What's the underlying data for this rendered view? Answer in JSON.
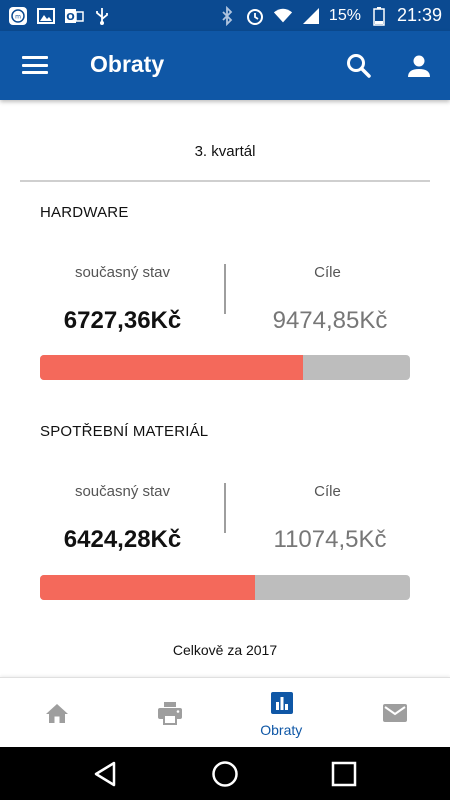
{
  "status_bar": {
    "battery": "15%",
    "time": "21:39",
    "icons": [
      "app-notification-icon",
      "gallery-icon",
      "outlook-icon",
      "usb-icon",
      "bluetooth-icon",
      "alarm-icon",
      "wifi-icon",
      "signal-icon",
      "battery-icon"
    ]
  },
  "app_bar": {
    "title": "Obraty",
    "icons": [
      "menu-icon",
      "search-icon",
      "user-icon"
    ]
  },
  "content": {
    "period": "3. kvartál",
    "sections": [
      {
        "title": "HARDWARE",
        "current_label": "současný stav",
        "current_value": "6727,36Kč",
        "target_label": "Cíle",
        "target_value": "9474,85Kč",
        "progress": 0.71
      },
      {
        "title": "SPOTŘEBNÍ MATERIÁL",
        "current_label": "současný stav",
        "current_value": "6424,28Kč",
        "target_label": "Cíle",
        "target_value": "11074,5Kč",
        "progress": 0.58
      }
    ],
    "total_label": "Celkově za 2017"
  },
  "bottom_nav": {
    "items": [
      {
        "icon": "home-icon",
        "label": ""
      },
      {
        "icon": "printer-icon",
        "label": ""
      },
      {
        "icon": "bar-chart-icon",
        "label": "Obraty",
        "active": true
      },
      {
        "icon": "mail-icon",
        "label": ""
      }
    ]
  },
  "colors": {
    "primary": "#0f57a6",
    "status_bar": "#0b4a91",
    "progress_fill": "#f4695b",
    "progress_track": "#bdbdbd",
    "inactive_icon": "#9e9e9e"
  }
}
